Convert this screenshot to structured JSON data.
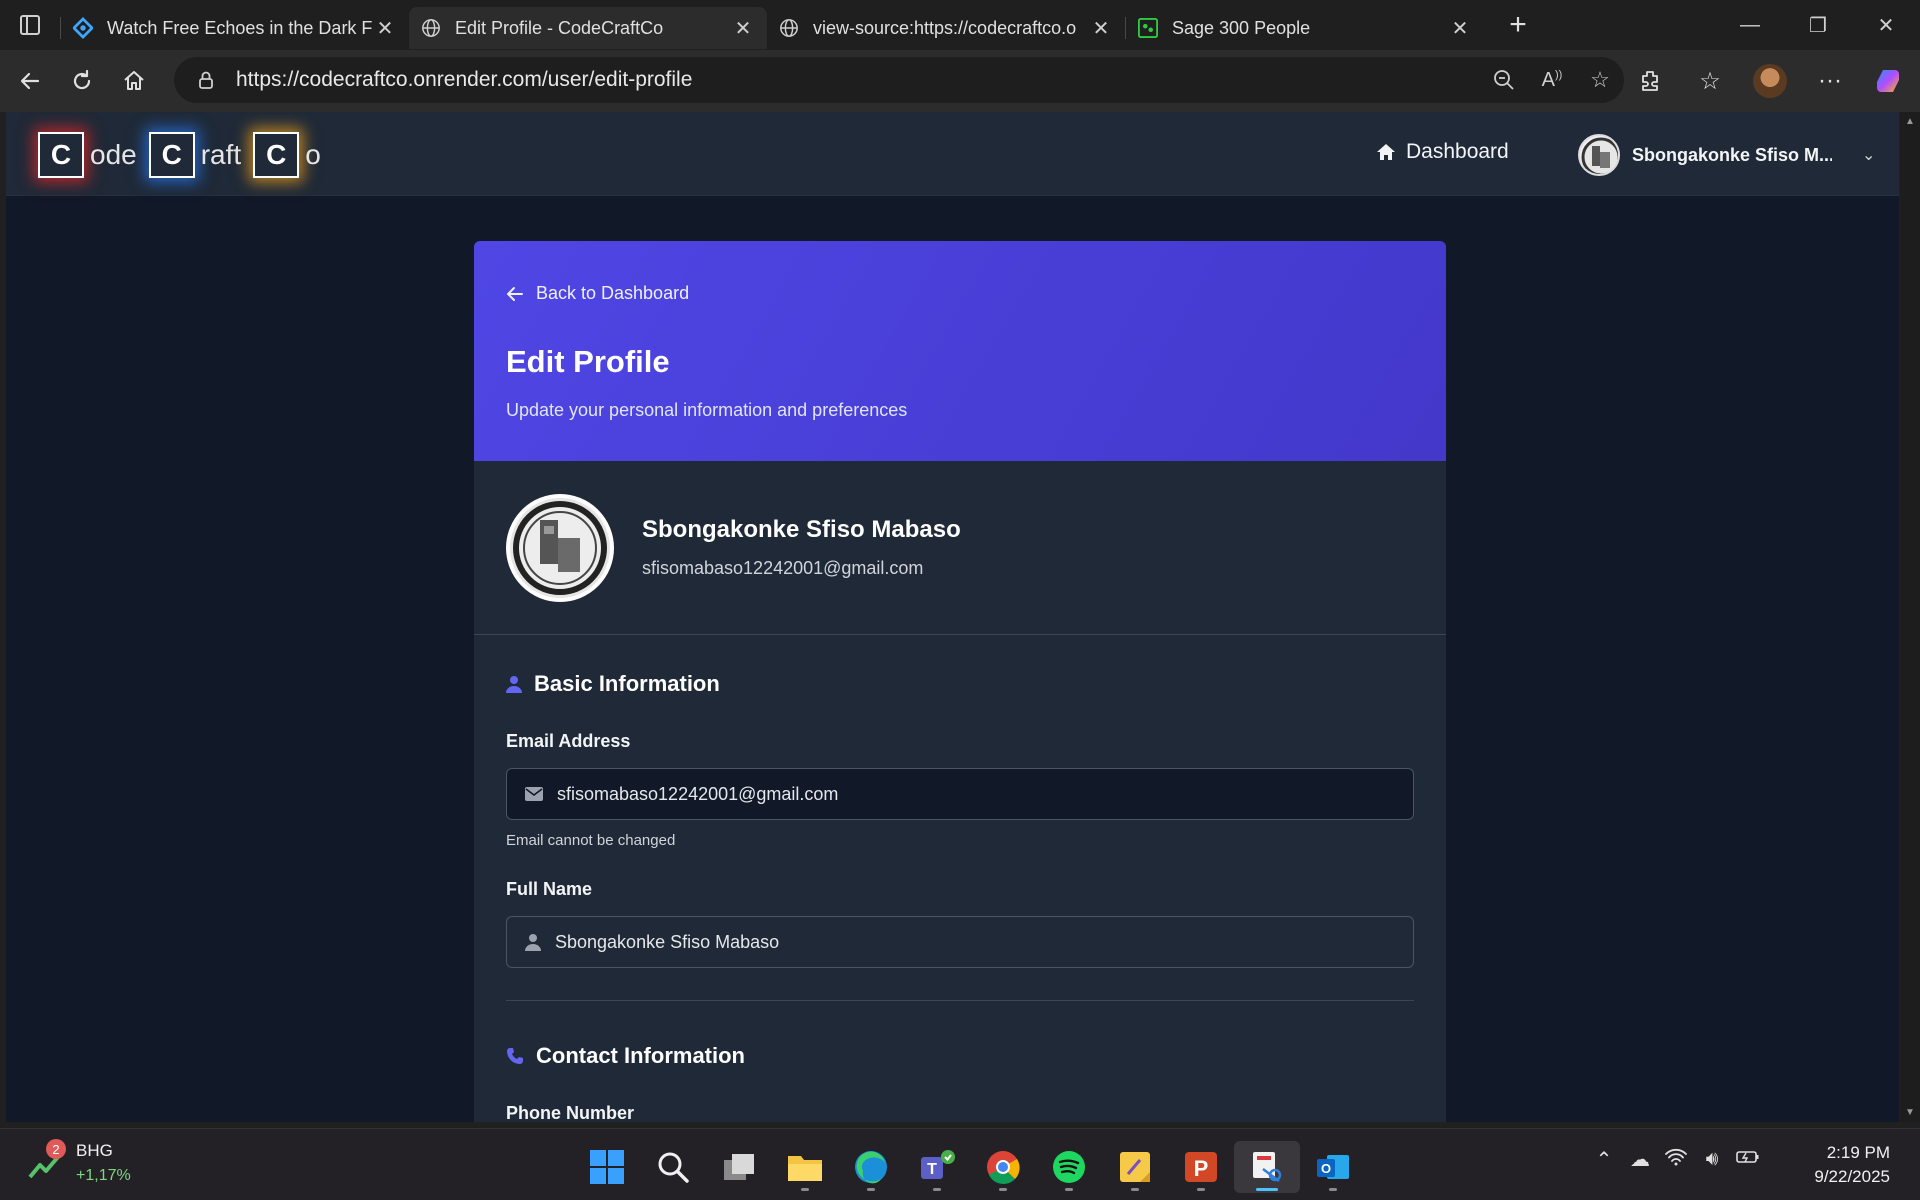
{
  "browser": {
    "tabs": [
      {
        "title": "Watch Free Echoes in the Dark Fu",
        "icon": "stream-site-icon",
        "active": false
      },
      {
        "title": "Edit Profile - CodeCraftCo",
        "icon": "globe-icon",
        "active": true
      },
      {
        "title": "view-source:https://codecraftco.o",
        "icon": "globe-icon",
        "active": false
      },
      {
        "title": "Sage 300 People",
        "icon": "sage-icon",
        "active": false
      }
    ],
    "url": "https://codecraftco.onrender.com/user/edit-profile"
  },
  "app": {
    "logo": {
      "letter1": "C",
      "text1": "ode",
      "letter2": "C",
      "text2": "raft",
      "letter3": "C",
      "text3": "o"
    },
    "nav": {
      "dashboard": "Dashboard"
    },
    "user_menu": {
      "name": "Sbongakonke Sfiso M..."
    }
  },
  "card": {
    "back_label": "Back to Dashboard",
    "title": "Edit Profile",
    "subtitle": "Update your personal information and preferences",
    "user": {
      "name": "Sbongakonke Sfiso Mabaso",
      "email": "sfisomabaso12242001@gmail.com"
    },
    "basic": {
      "title": "Basic Information",
      "email_label": "Email Address",
      "email_value": "sfisomabaso12242001@gmail.com",
      "email_hint": "Email cannot be changed",
      "name_label": "Full Name",
      "name_value": "Sbongakonke Sfiso Mabaso"
    },
    "contact": {
      "title": "Contact Information",
      "phone_label": "Phone Number"
    }
  },
  "taskbar": {
    "stock": {
      "badge": "2",
      "symbol": "BHG",
      "change": "+1,17%"
    },
    "time": "2:19 PM",
    "date": "9/22/2025"
  },
  "colors": {
    "accent": "#4f46e5",
    "page_bg": "#111827",
    "card_bg": "#1f2937"
  }
}
